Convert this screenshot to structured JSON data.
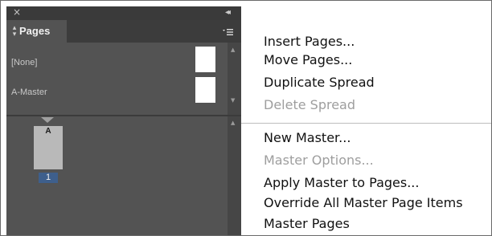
{
  "panel": {
    "close_glyph": "×",
    "collapse_glyph": "◂◂",
    "tab": {
      "updown_glyph": "⬍",
      "label": "Pages"
    },
    "menu_button_glyph": "▾≡",
    "masters": [
      {
        "label": "[None]"
      },
      {
        "label": "A-Master"
      }
    ],
    "pages": [
      {
        "master_letter": "A",
        "number": "1"
      }
    ],
    "scroll_up_glyph": "▲",
    "scroll_down_glyph": "▼"
  },
  "menu": {
    "items": [
      {
        "label": "Insert Pages...",
        "enabled": true
      },
      {
        "label": "Move Pages...",
        "enabled": true
      },
      {
        "label": "Duplicate Spread",
        "enabled": true
      },
      {
        "label": "Delete Spread",
        "enabled": false
      },
      {
        "label": "New Master...",
        "enabled": true
      },
      {
        "label": "Master Options...",
        "enabled": false
      },
      {
        "label": "Apply Master to Pages...",
        "enabled": true
      },
      {
        "label": "Override All Master Page Items",
        "enabled": true
      },
      {
        "label": "Master Pages",
        "enabled": true
      }
    ]
  },
  "colors": {
    "panel_bg": "#535353",
    "panel_dark": "#3a3a3a",
    "selected_page_number": "#3e5f8c",
    "menu_text": "#111111",
    "menu_disabled_text": "#9e9e9e"
  },
  "icons": {
    "close": "close-icon",
    "collapse": "double-chevron-left-icon",
    "tab_sort": "updown-arrows-icon",
    "panel_menu": "panel-menu-icon"
  }
}
